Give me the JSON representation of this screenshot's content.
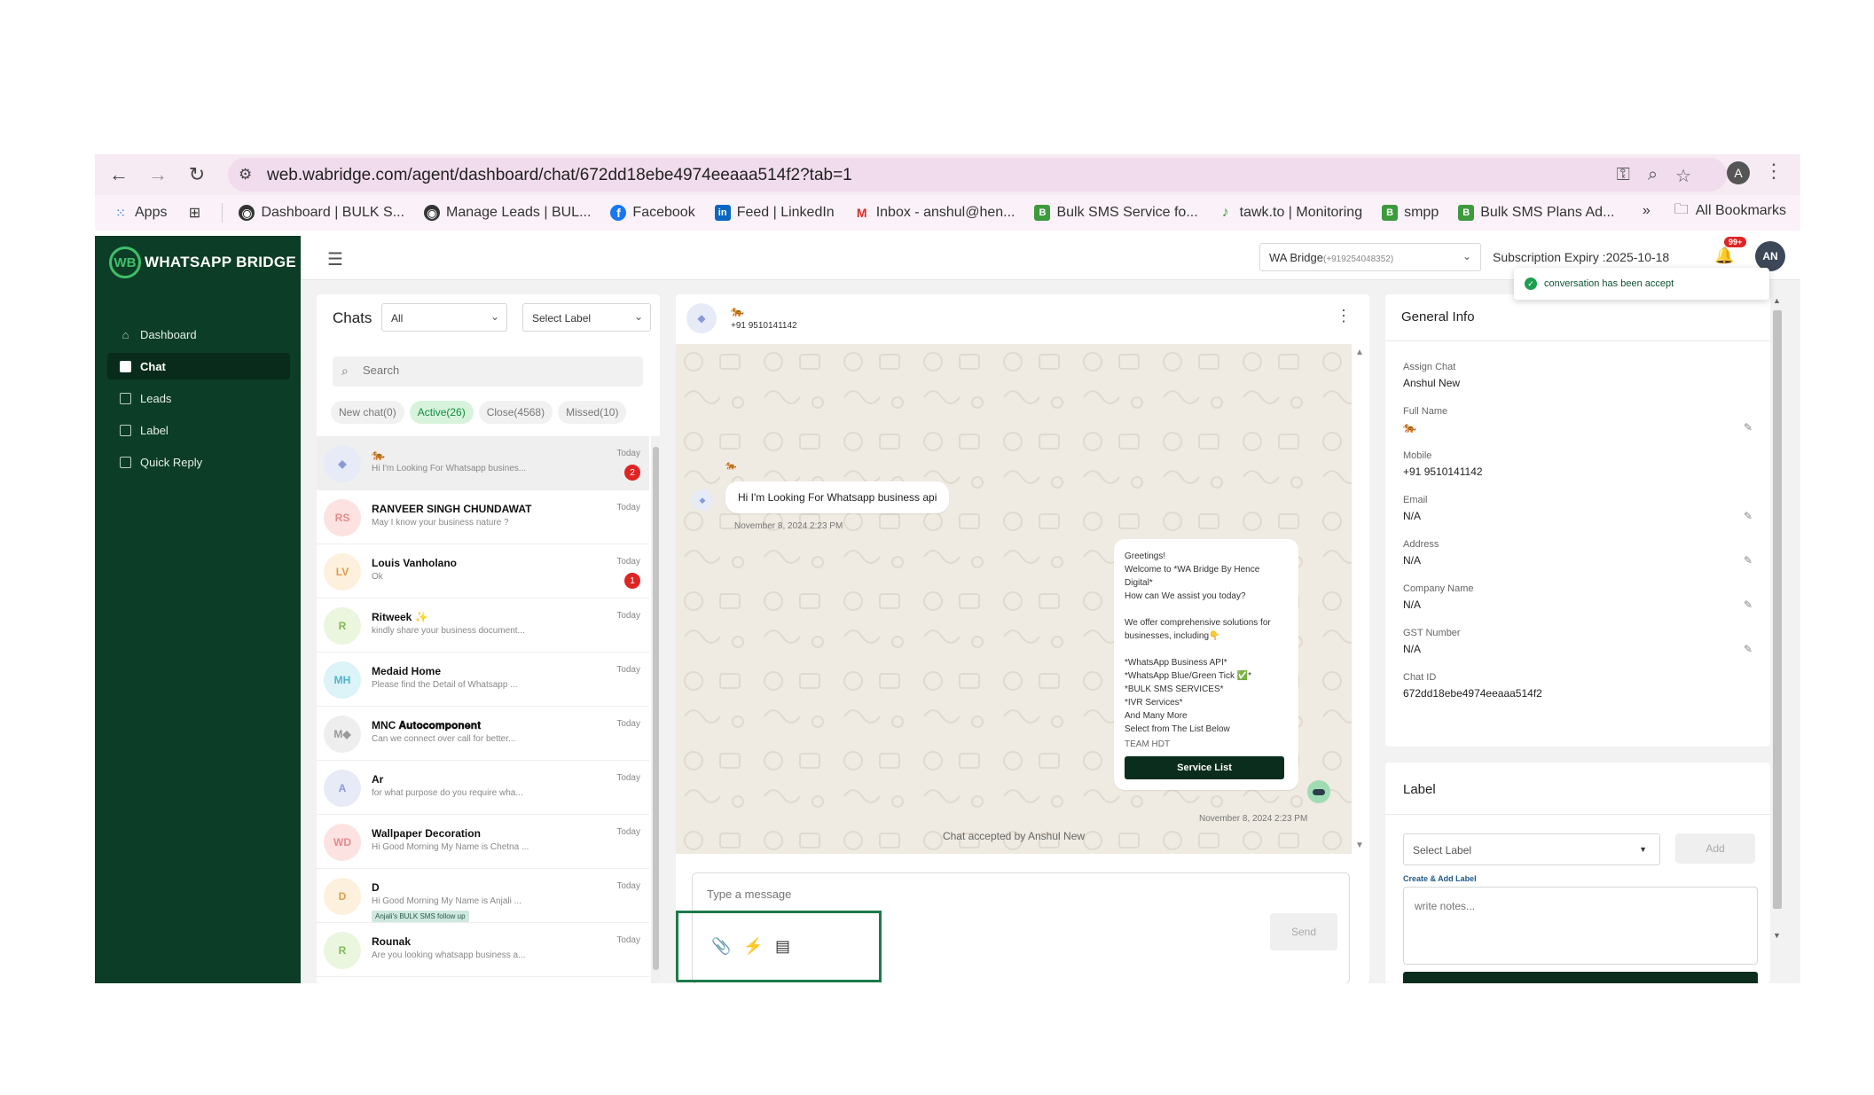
{
  "browser": {
    "url": "web.wabridge.com/agent/dashboard/chat/672dd18ebe4974eeaaa514f2?tab=1",
    "profile_initial": "A",
    "bookmarks": [
      {
        "label": "Apps",
        "icon": "apps-grid-icon"
      },
      {
        "label": "Dashboard | BULK S...",
        "icon": "globe-icon"
      },
      {
        "label": "Manage Leads | BUL...",
        "icon": "globe-icon"
      },
      {
        "label": "Facebook",
        "icon": "facebook-icon"
      },
      {
        "label": "Feed | LinkedIn",
        "icon": "linkedin-icon"
      },
      {
        "label": "Inbox - anshul@hen...",
        "icon": "gmail-icon"
      },
      {
        "label": "Bulk SMS Service fo...",
        "icon": "bulksms-icon"
      },
      {
        "label": "tawk.to | Monitoring",
        "icon": "tawk-icon"
      },
      {
        "label": "smpp",
        "icon": "bulksms-icon"
      },
      {
        "label": "Bulk SMS Plans Ad...",
        "icon": "bulksms-icon"
      }
    ],
    "all_bookmarks": "All Bookmarks"
  },
  "app": {
    "logo_text": "WHATSAPP BRIDGE",
    "logo_mark": "WB",
    "menu": [
      {
        "label": "Dashboard",
        "active": false
      },
      {
        "label": "Chat",
        "active": true
      },
      {
        "label": "Leads",
        "active": false
      },
      {
        "label": "Label",
        "active": false
      },
      {
        "label": "Quick Reply",
        "active": false
      }
    ],
    "topbar": {
      "wa_select_name": "WA Bridge",
      "wa_select_number": "(+919254048352)",
      "subscription": "Subscription Expiry :2025-10-18",
      "notif_badge": "99+",
      "avatar": "AN",
      "toast": "conversation has been accept"
    }
  },
  "chats": {
    "title": "Chats",
    "filter_select": "All",
    "label_select": "Select Label",
    "search_placeholder": "Search",
    "pills": [
      {
        "label": "New chat(0)",
        "active": false
      },
      {
        "label": "Active(26)",
        "active": true
      },
      {
        "label": "Close(4568)",
        "active": false
      },
      {
        "label": "Missed(10)",
        "active": false
      }
    ],
    "list": [
      {
        "initials": "◆",
        "name": "🐅",
        "preview": "Hi I'm Looking For Whatsapp busines...",
        "time": "Today",
        "badge": "2",
        "tag": "",
        "bg": "#e6ebf7",
        "fg": "#8a9ad6"
      },
      {
        "initials": "RS",
        "name": "RANVEER SINGH CHUNDAWAT",
        "preview": "May I know your business nature ?",
        "time": "Today",
        "badge": "",
        "tag": "",
        "bg": "#fde2e2",
        "fg": "#e58a8a"
      },
      {
        "initials": "LV",
        "name": "Louis Vanholano",
        "preview": "Ok",
        "time": "Today",
        "badge": "1",
        "tag": "",
        "bg": "#fdf0dc",
        "fg": "#d9a04a"
      },
      {
        "initials": "R",
        "name": "Ritweek ✨",
        "preview": "kindly share your business document...",
        "time": "Today",
        "badge": "",
        "tag": "",
        "bg": "#eaf6dd",
        "fg": "#84b85a"
      },
      {
        "initials": "MH",
        "name": "Medaid Home",
        "preview": "Please find the Detail of Whatsapp ...",
        "time": "Today",
        "badge": "",
        "tag": "",
        "bg": "#dcf3f7",
        "fg": "#4fb5c9"
      },
      {
        "initials": "M◆",
        "name": "MNC 𝐀𝐮𝐭𝐨𝐜𝐨𝐦𝐩𝐨𝐧𝐞𝐧𝐭",
        "preview": "Can we connect over call for better...",
        "time": "Today",
        "badge": "",
        "tag": "",
        "bg": "#eeeeee",
        "fg": "#999999"
      },
      {
        "initials": "A",
        "name": "Ar",
        "preview": "for what purpose do you require wha...",
        "time": "Today",
        "badge": "",
        "tag": "",
        "bg": "#e6ebf7",
        "fg": "#8a9ad6"
      },
      {
        "initials": "WD",
        "name": "Wallpaper Decoration",
        "preview": "Hi Good Morning My Name is Chetna ...",
        "time": "Today",
        "badge": "",
        "tag": "",
        "bg": "#fde2e2",
        "fg": "#e58a8a"
      },
      {
        "initials": "D",
        "name": "D",
        "preview": "Hi Good Morning My Name is Anjali ...",
        "time": "Today",
        "badge": "",
        "tag": "Anjali's BULK SMS follow up",
        "bg": "#fdf0dc",
        "fg": "#d9a04a"
      },
      {
        "initials": "R",
        "name": "Rounak",
        "preview": "Are you looking whatsapp business a...",
        "time": "Today",
        "badge": "",
        "tag": "",
        "bg": "#eaf6dd",
        "fg": "#84b85a"
      }
    ]
  },
  "conversation": {
    "contact_emoji": "🐅",
    "contact_phone": "+91 9510141142",
    "incoming_emoji": "🐅",
    "incoming_text": "Hi I'm Looking For Whatsapp business api",
    "incoming_time": "November 8, 2024 2:23 PM",
    "outgoing_lines": [
      "Greetings!",
      "Welcome to *WA Bridge By Hence",
      "Digital*",
      "How can We assist you today?",
      "",
      "We offer comprehensive solutions for",
      "businesses, including👇",
      "",
      "*WhatsApp Business API*",
      "*WhatsApp Blue/Green Tick ✅*",
      "*BULK SMS SERVICES*",
      "*IVR Services*",
      "And Many More",
      "Select from The List Below"
    ],
    "outgoing_team": "TEAM HDT",
    "service_button": "Service List",
    "outgoing_time": "November 8, 2024 2:23 PM",
    "accepted_text": "Chat accepted by Anshul New",
    "message_placeholder": "Type a message",
    "send_label": "Send"
  },
  "info": {
    "title": "General Info",
    "fields": [
      {
        "label": "Assign Chat",
        "value": "Anshul New",
        "editable": false
      },
      {
        "label": "Full Name",
        "value": "🐅",
        "editable": true
      },
      {
        "label": "Mobile",
        "value": "+91 9510141142",
        "editable": false
      },
      {
        "label": "Email",
        "value": "N/A",
        "editable": true
      },
      {
        "label": "Address",
        "value": "N/A",
        "editable": true
      },
      {
        "label": "Company Name",
        "value": "N/A",
        "editable": true
      },
      {
        "label": "GST Number",
        "value": "N/A",
        "editable": true
      },
      {
        "label": "Chat ID",
        "value": "672dd18ebe4974eeaaa514f2",
        "editable": false
      }
    ]
  },
  "label_card": {
    "title": "Label",
    "select_placeholder": "Select Label",
    "add_label": "Add",
    "create_label": "Create & Add Label",
    "notes_placeholder": "write notes..."
  }
}
